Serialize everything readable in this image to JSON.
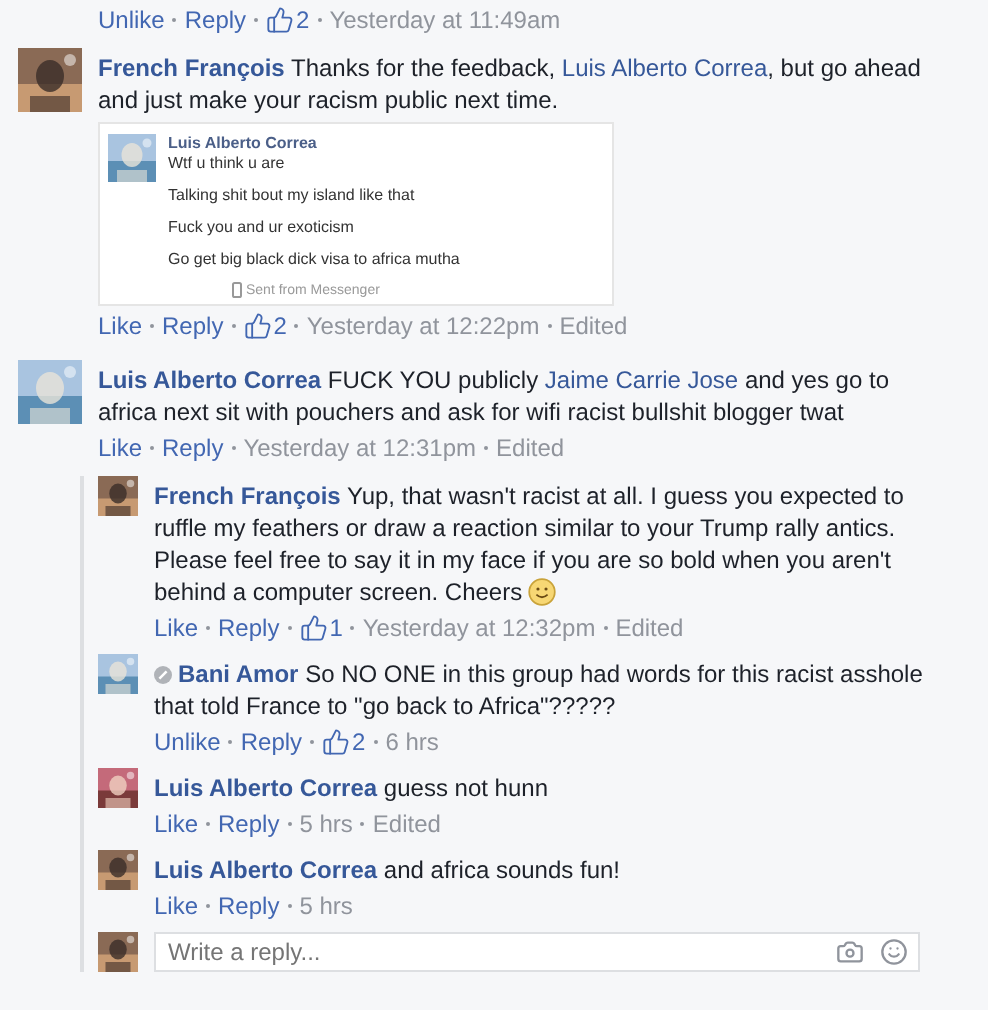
{
  "previous_actions": [
    {
      "kind": "like",
      "text": "Unlike"
    },
    {
      "kind": "reply",
      "text": "Reply"
    },
    {
      "kind": "likes",
      "text": "2"
    },
    {
      "kind": "time",
      "text": "Yesterday at 11:49am"
    }
  ],
  "comments": [
    {
      "author": "French François",
      "parts": [
        {
          "kind": "plain",
          "text": "Thanks for the feedback, "
        },
        {
          "kind": "mention",
          "text": "Luis Alberto Correa"
        },
        {
          "kind": "plain",
          "text": ", but go ahead and just make your racism public next time."
        }
      ],
      "attachment": {
        "author": "Luis Alberto Correa",
        "lines": [
          "Wtf u think u are",
          "Talking shit bout my island like that",
          "Fuck you and ur exoticism",
          "Go get big black dick visa to africa mutha"
        ],
        "footer": "Sent from Messenger"
      },
      "actions": [
        {
          "kind": "like",
          "text": "Like"
        },
        {
          "kind": "reply",
          "text": "Reply"
        },
        {
          "kind": "likes",
          "text": "2"
        },
        {
          "kind": "time",
          "text": "Yesterday at 12:22pm"
        },
        {
          "kind": "edited",
          "text": "Edited"
        }
      ]
    },
    {
      "author": "Luis Alberto Correa",
      "parts": [
        {
          "kind": "plain",
          "text": "FUCK YOU publicly "
        },
        {
          "kind": "mention",
          "text": "Jaime Carrie Jose"
        },
        {
          "kind": "plain",
          "text": " and yes go to africa next sit with pouchers and ask for wifi racist bullshit blogger twat"
        }
      ],
      "actions": [
        {
          "kind": "like",
          "text": "Like"
        },
        {
          "kind": "reply",
          "text": "Reply"
        },
        {
          "kind": "time",
          "text": "Yesterday at 12:31pm"
        },
        {
          "kind": "edited",
          "text": "Edited"
        }
      ],
      "children": [
        {
          "author": "French François",
          "parts": [
            {
              "kind": "plain",
              "text": "Yup, that wasn't racist at all. I guess you expected to ruffle my feathers or draw a reaction similar to your Trump rally antics. Please feel free to say it in my face if you are so bold when you aren't behind a computer screen. Cheers "
            },
            {
              "kind": "emoji"
            }
          ],
          "actions": [
            {
              "kind": "like",
              "text": "Like"
            },
            {
              "kind": "reply",
              "text": "Reply"
            },
            {
              "kind": "likes",
              "text": "1"
            },
            {
              "kind": "time",
              "text": "Yesterday at 12:32pm"
            },
            {
              "kind": "edited",
              "text": "Edited"
            }
          ]
        },
        {
          "author": "Bani Amor",
          "badge": true,
          "parts": [
            {
              "kind": "plain",
              "text": "So NO ONE in this group had words for this racist asshole that told France to \"go back to Africa\"?????"
            }
          ],
          "actions": [
            {
              "kind": "like",
              "text": "Unlike"
            },
            {
              "kind": "reply",
              "text": "Reply"
            },
            {
              "kind": "likes",
              "text": "2"
            },
            {
              "kind": "time",
              "text": "6 hrs"
            }
          ]
        },
        {
          "author": "Luis Alberto Correa",
          "parts": [
            {
              "kind": "plain",
              "text": "guess not hunn"
            }
          ],
          "actions": [
            {
              "kind": "like",
              "text": "Like"
            },
            {
              "kind": "reply",
              "text": "Reply"
            },
            {
              "kind": "time",
              "text": "5 hrs"
            },
            {
              "kind": "edited",
              "text": "Edited"
            }
          ]
        },
        {
          "author": "Luis Alberto Correa",
          "parts": [
            {
              "kind": "plain",
              "text": "and africa sounds fun!"
            }
          ],
          "actions": [
            {
              "kind": "like",
              "text": "Like"
            },
            {
              "kind": "reply",
              "text": "Reply"
            },
            {
              "kind": "time",
              "text": "5 hrs"
            }
          ]
        }
      ],
      "reply_field": {
        "placeholder": "Write a reply..."
      }
    }
  ]
}
